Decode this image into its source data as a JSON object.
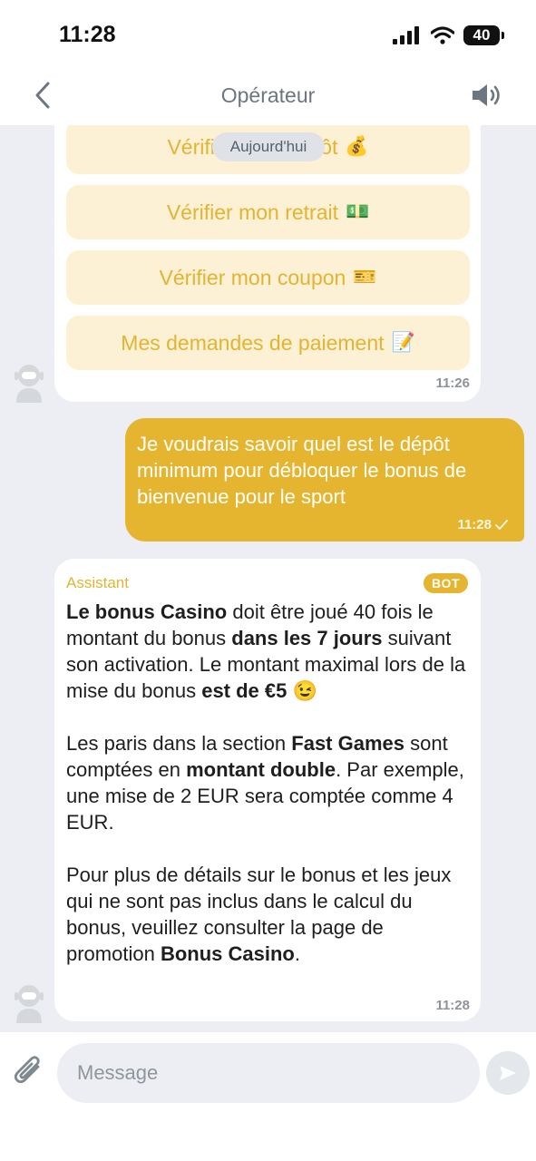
{
  "status_bar": {
    "time": "11:28",
    "battery": "40"
  },
  "nav": {
    "title": "Opérateur"
  },
  "day_separator": "Aujourd'hui",
  "quick_buttons": [
    {
      "label": "Vérifier mon dépôt",
      "emoji": "💰"
    },
    {
      "label": "Vérifier mon retrait",
      "emoji": "💵"
    },
    {
      "label": "Vérifier mon coupon",
      "emoji": "🎫"
    },
    {
      "label": "Mes demandes de paiement",
      "emoji": "📝"
    }
  ],
  "quick_buttons_time": "11:26",
  "user_message": {
    "text": "Je voudrais savoir quel est le dépôt minimum pour débloquer le bonus de bienvenue pour le sport",
    "time": "11:28"
  },
  "bot_message": {
    "sender": "Assistant",
    "badge": "BOT",
    "p1": [
      {
        "text": "Le bonus Casino",
        "bold": true
      },
      {
        "text": " doit être joué 40 fois le montant du bonus ",
        "bold": false
      },
      {
        "text": "dans les 7 jours",
        "bold": true
      },
      {
        "text": " suivant son activation. Le montant maximal lors de la mise du bonus ",
        "bold": false
      },
      {
        "text": "est de €5",
        "bold": true
      },
      {
        "text": " 😉",
        "bold": false
      }
    ],
    "p2": [
      {
        "text": "Les paris dans la section ",
        "bold": false
      },
      {
        "text": "Fast Games",
        "bold": true
      },
      {
        "text": " sont comptées en ",
        "bold": false
      },
      {
        "text": "montant double",
        "bold": true
      },
      {
        "text": ". Par exemple, une mise de 2 EUR sera comptée comme 4 EUR.",
        "bold": false
      }
    ],
    "p3": [
      {
        "text": "Pour plus de détails sur le bonus et les jeux qui ne sont pas inclus dans le calcul du bonus, veuillez consulter la page de promotion ",
        "bold": false
      },
      {
        "text": "Bonus Casino",
        "bold": true
      },
      {
        "text": ".",
        "bold": false
      }
    ],
    "time": "11:28"
  },
  "input": {
    "placeholder": "Message"
  },
  "colors": {
    "accent": "#e6b52f",
    "button_bg": "#fcf1d4",
    "button_text": "#e2b431",
    "chat_bg": "#eceef3"
  }
}
